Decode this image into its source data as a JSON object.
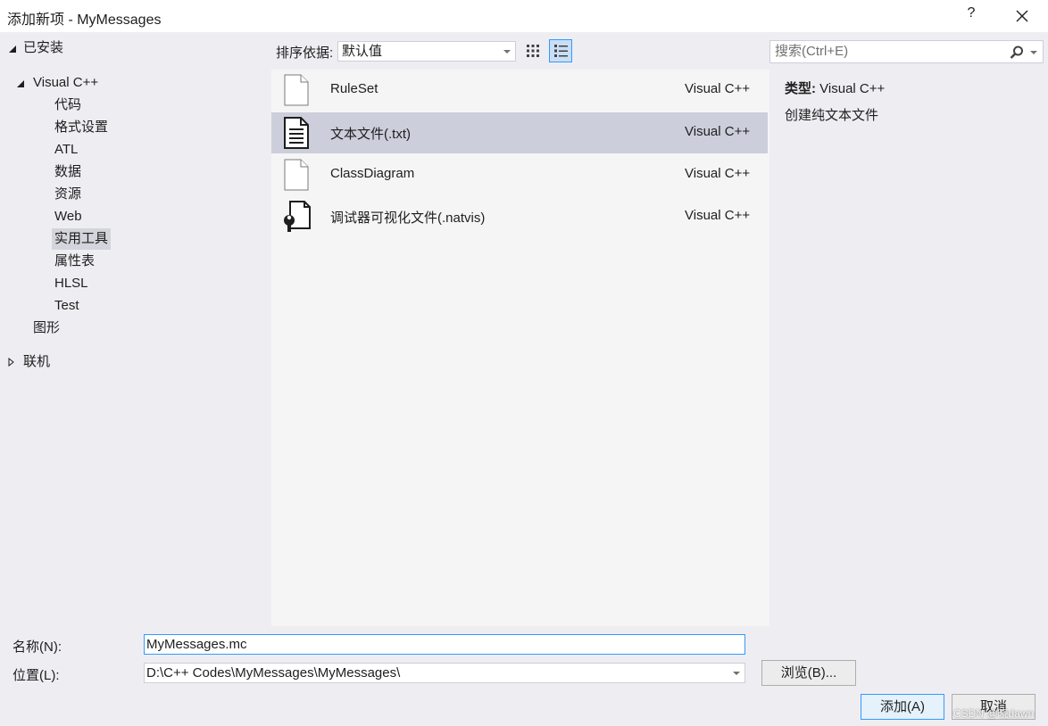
{
  "window": {
    "title": "添加新项 - MyMessages",
    "help_label": "?"
  },
  "tree": {
    "installed_label": "已安装",
    "visual_cpp_label": "Visual C++",
    "children": [
      "代码",
      "格式设置",
      "ATL",
      "数据",
      "资源",
      "Web",
      "实用工具",
      "属性表",
      "HLSL",
      "Test"
    ],
    "selected_child": "实用工具",
    "graphics_label": "图形",
    "online_label": "联机"
  },
  "toolbar": {
    "sort_label": "排序依据:",
    "sort_value": "默认值",
    "search_placeholder": "搜索(Ctrl+E)"
  },
  "items": [
    {
      "name": "RuleSet",
      "lang": "Visual C++",
      "icon": "blank-file-icon",
      "selected": false
    },
    {
      "name": "文本文件(.txt)",
      "lang": "Visual C++",
      "icon": "text-file-icon",
      "selected": true
    },
    {
      "name": "ClassDiagram",
      "lang": "Visual C++",
      "icon": "blank-file-icon",
      "selected": false
    },
    {
      "name": "调试器可视化文件(.natvis)",
      "lang": "Visual C++",
      "icon": "debugger-file-icon",
      "selected": false
    }
  ],
  "details": {
    "type_label": "类型:",
    "type_value": "Visual C++",
    "description": "创建纯文本文件"
  },
  "form": {
    "name_label": "名称(N):",
    "name_value": "MyMessages.mc",
    "location_label": "位置(L):",
    "location_value": "D:\\C++ Codes\\MyMessages\\MyMessages\\",
    "browse_label": "浏览(B)...",
    "add_label": "添加(A)",
    "cancel_label": "取消"
  },
  "watermark": "CSDN @晓dawn"
}
